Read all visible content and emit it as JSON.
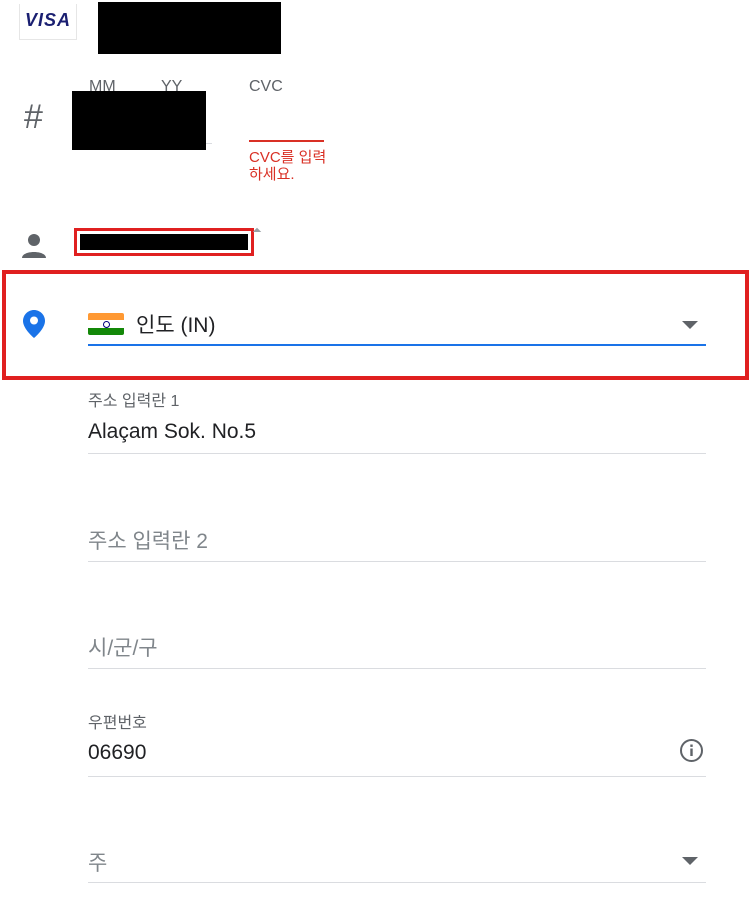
{
  "card": {
    "brand": "VISA",
    "expiry_month_label": "MM",
    "expiry_year_label": "YY",
    "cvc_label": "CVC",
    "cvc_error": "CVC를 입력하세요.",
    "number_icon": "#"
  },
  "icons": {
    "person": "person-icon",
    "location": "location-pin-icon",
    "info": "info-icon",
    "dropdown": "chevron-down-icon"
  },
  "address": {
    "country": "인도 (IN)",
    "line1_label": "주소 입력란 1",
    "line1_value": "Alaçam Sok. No.5",
    "line2_placeholder": "주소 입력란 2",
    "city_placeholder": "시/군/구",
    "postal_label": "우편번호",
    "postal_value": "06690",
    "state_placeholder": "주"
  },
  "colors": {
    "accent": "#1a73e8",
    "error": "#d93025",
    "highlight": "#e02020"
  }
}
